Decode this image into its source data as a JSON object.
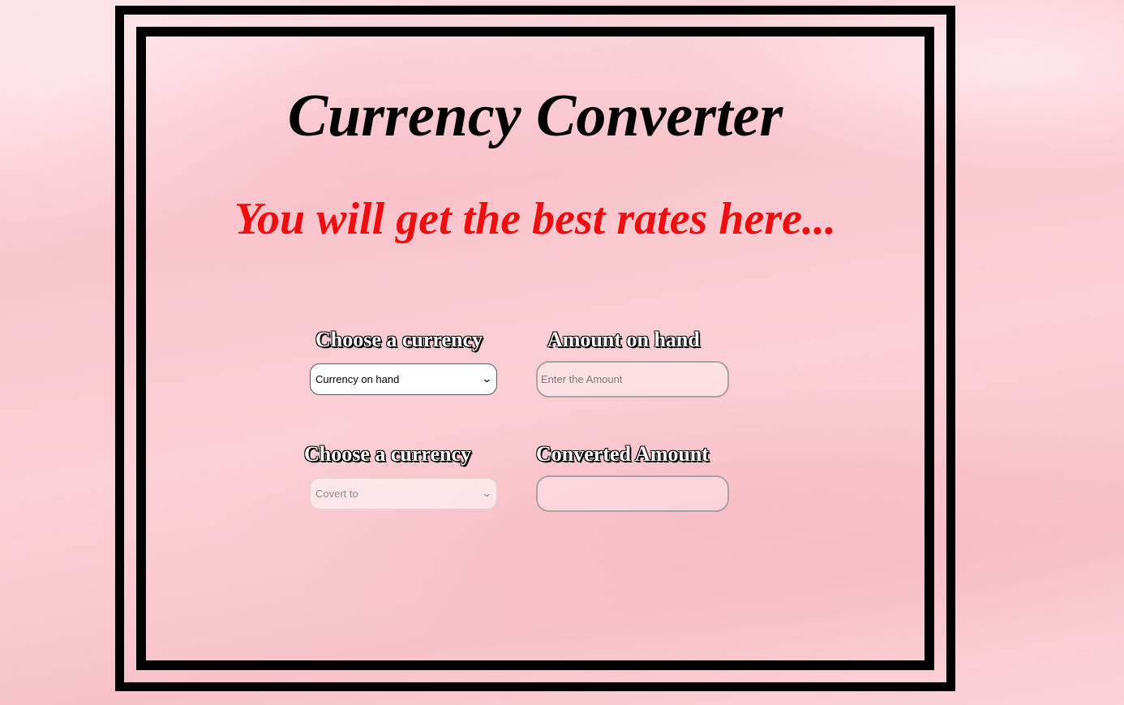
{
  "header": {
    "title": "Currency Converter",
    "subtitle": "You will get the best rates here..."
  },
  "form": {
    "from_label": "Choose a currency",
    "from_select_value": "Currency on hand",
    "amount_label": "Amount on hand",
    "amount_placeholder": "Enter the Amount",
    "to_label": "Choose a currency",
    "to_select_value": "Covert to",
    "converted_label": "Converted Amount",
    "converted_value": ""
  },
  "colors": {
    "title": "#000000",
    "subtitle": "#f00d0d",
    "frame": "#000000",
    "background": "#f9c5cd"
  },
  "icons": {
    "select_arrow": "chevron-down-icon"
  }
}
